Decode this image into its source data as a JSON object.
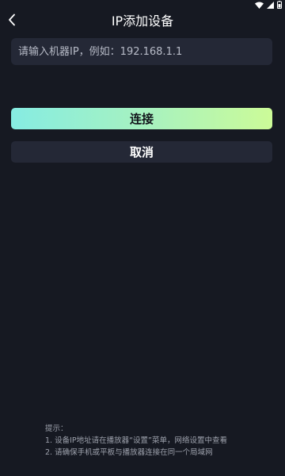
{
  "status_bar": {
    "icons": [
      "wifi-icon",
      "signal-icon",
      "battery-icon"
    ]
  },
  "nav": {
    "back_icon": "chevron-left-icon",
    "title": "IP添加设备"
  },
  "form": {
    "ip_placeholder": "请输入机器IP，例如：192.168.1.1",
    "ip_value": ""
  },
  "actions": {
    "connect_label": "连接",
    "cancel_label": "取消"
  },
  "tips": {
    "heading": "提示：",
    "items": [
      "1. 设备IP地址请在播放器“设置”菜单，网络设置中查看",
      "2. 请确保手机或平板与播放器连接在同一个局域网"
    ]
  },
  "colors": {
    "background": "#161922",
    "surface": "#242836",
    "accent_gradient_start": "#86ece2",
    "accent_gradient_end": "#ccfb98",
    "tip_text": "#9ea2ad"
  }
}
